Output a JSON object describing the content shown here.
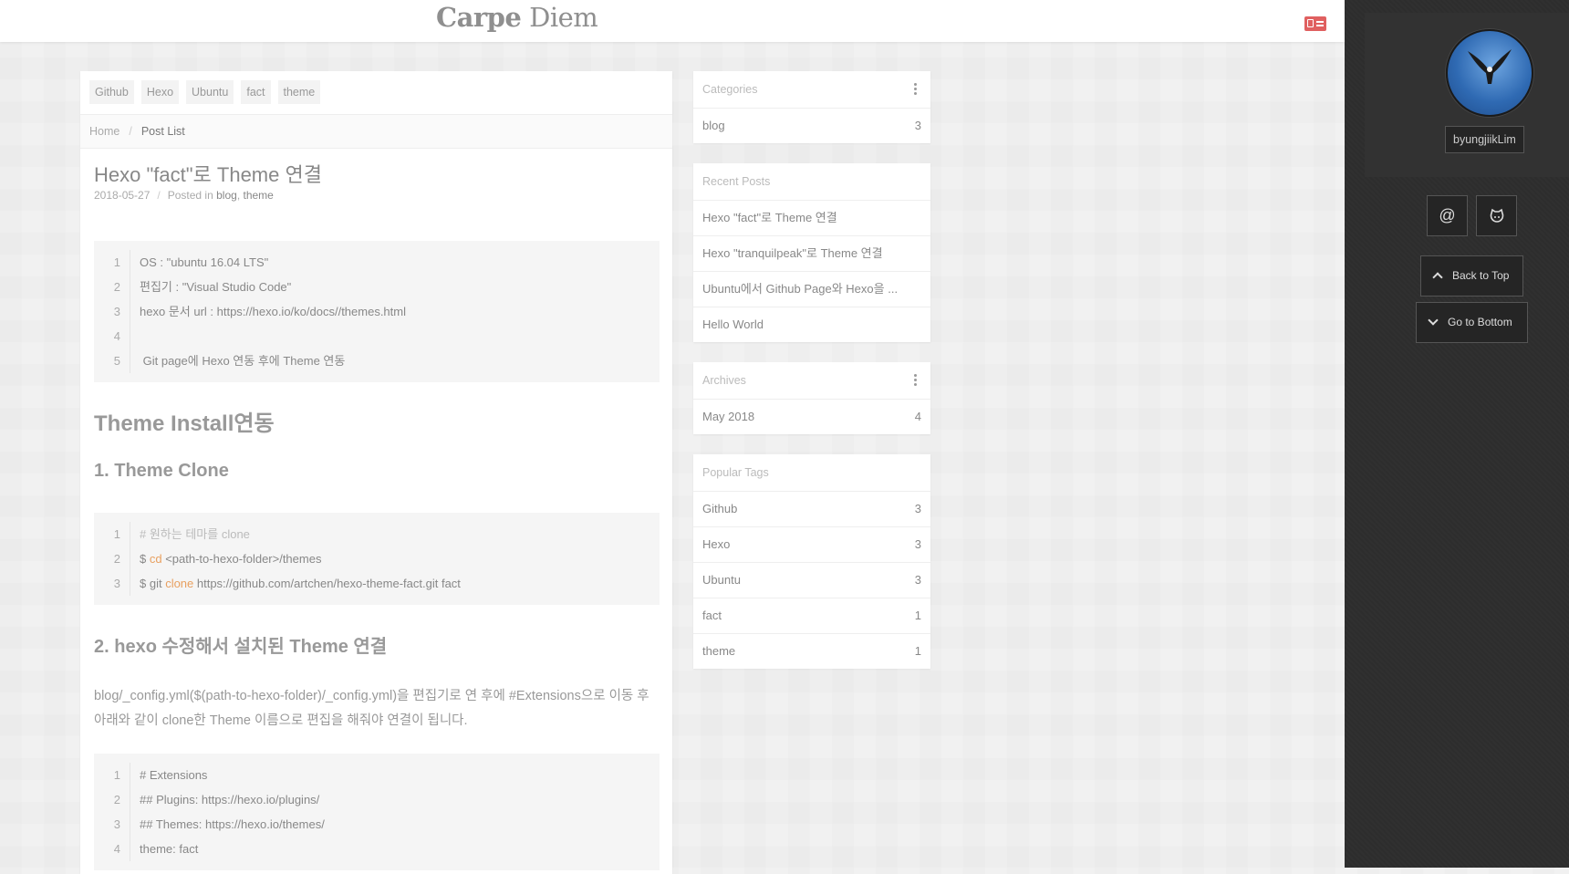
{
  "header": {
    "brand_bold": "Carpe",
    "brand_light": "Diem"
  },
  "post": {
    "tags": [
      "Github",
      "Hexo",
      "Ubuntu",
      "fact",
      "theme"
    ],
    "breadcrumb": {
      "home": "Home",
      "separator": "/",
      "current": "Post List"
    },
    "title": "Hexo \"fact\"로 Theme 연결",
    "date": "2018-05-27",
    "meta_sep": "/",
    "posted_in": "Posted in",
    "categories": [
      "blog",
      "theme"
    ],
    "code1": [
      {
        "n": "1",
        "text": "OS : \"ubuntu 16.04 LTS\""
      },
      {
        "n": "2",
        "text": "편집기 : \"Visual Studio Code\""
      },
      {
        "n": "3",
        "text": "hexo 문서 url : https://hexo.io/ko/docs//themes.html"
      },
      {
        "n": "4",
        "text": ""
      },
      {
        "n": "5",
        "text": " Git page에 Hexo 연동 후에 Theme 연동"
      }
    ],
    "h_install": "Theme Install연동",
    "h_clone": "1. Theme Clone",
    "code2": {
      "line1_n": "1",
      "line1": "# 원하는 테마를 clone",
      "line2_n": "2",
      "line2_a": "$ ",
      "line2_kw": "cd",
      "line2_b": " <path-to-hexo-folder>/themes",
      "line3_n": "3",
      "line3_a": "$ git ",
      "line3_kw": "clone",
      "line3_b": " https://github.com/artchen/hexo-theme-fact.git fact"
    },
    "h_config": "2. hexo 수정해서 설치된 Theme 연결",
    "paragraph": "blog/_config.yml($(path-to-hexo-folder)/_config.yml)을 편집기로 연 후에 #Extensions으로 이동 후 아래와 같이 clone한 Theme 이름으로 편집을 해줘야 연결이 됩니다.",
    "code3": [
      {
        "n": "1",
        "text": "# Extensions"
      },
      {
        "n": "2",
        "text": "## Plugins: https://hexo.io/plugins/"
      },
      {
        "n": "3",
        "text": "## Themes: https://hexo.io/themes/"
      },
      {
        "n": "4",
        "text": "theme: fact"
      }
    ]
  },
  "widgets": {
    "categories": {
      "title": "Categories",
      "items": [
        {
          "label": "blog",
          "count": "3"
        }
      ]
    },
    "recent": {
      "title": "Recent Posts",
      "items": [
        "Hexo \"fact\"로 Theme 연결",
        "Hexo \"tranquilpeak\"로 Theme 연결",
        "Ubuntu에서 Github Page와 Hexo을 ...",
        "Hello World"
      ]
    },
    "archives": {
      "title": "Archives",
      "items": [
        {
          "label": "May 2018",
          "count": "4"
        }
      ]
    },
    "tags": {
      "title": "Popular Tags",
      "items": [
        {
          "label": "Github",
          "count": "3"
        },
        {
          "label": "Hexo",
          "count": "3"
        },
        {
          "label": "Ubuntu",
          "count": "3"
        },
        {
          "label": "fact",
          "count": "1"
        },
        {
          "label": "theme",
          "count": "1"
        }
      ]
    }
  },
  "sidebar": {
    "author": "byungjiikLim",
    "email_symbol": "@",
    "back_to_top": "Back to Top",
    "go_to_bottom": "Go to Bottom"
  },
  "colors": {
    "accent": "#e06060",
    "code_keyword": "#e8a060",
    "sidebar_bg": "#2d2d2d"
  }
}
